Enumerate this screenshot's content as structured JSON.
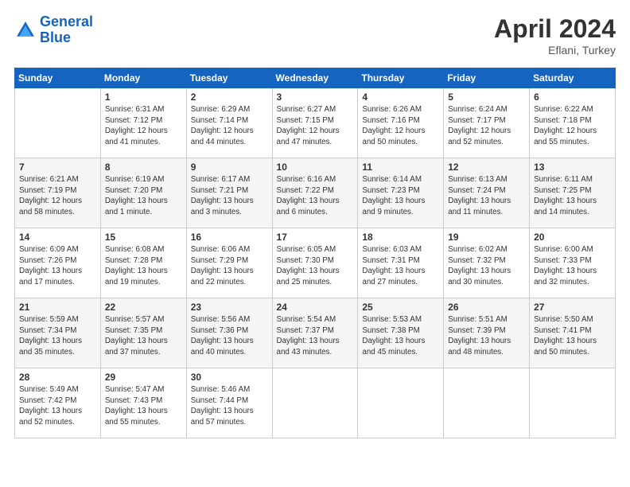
{
  "header": {
    "logo_line1": "General",
    "logo_line2": "Blue",
    "month_year": "April 2024",
    "location": "Eflani, Turkey"
  },
  "days_of_week": [
    "Sunday",
    "Monday",
    "Tuesday",
    "Wednesday",
    "Thursday",
    "Friday",
    "Saturday"
  ],
  "weeks": [
    [
      {
        "day": "",
        "sunrise": "",
        "sunset": "",
        "daylight": ""
      },
      {
        "day": "1",
        "sunrise": "Sunrise: 6:31 AM",
        "sunset": "Sunset: 7:12 PM",
        "daylight": "Daylight: 12 hours and 41 minutes."
      },
      {
        "day": "2",
        "sunrise": "Sunrise: 6:29 AM",
        "sunset": "Sunset: 7:14 PM",
        "daylight": "Daylight: 12 hours and 44 minutes."
      },
      {
        "day": "3",
        "sunrise": "Sunrise: 6:27 AM",
        "sunset": "Sunset: 7:15 PM",
        "daylight": "Daylight: 12 hours and 47 minutes."
      },
      {
        "day": "4",
        "sunrise": "Sunrise: 6:26 AM",
        "sunset": "Sunset: 7:16 PM",
        "daylight": "Daylight: 12 hours and 50 minutes."
      },
      {
        "day": "5",
        "sunrise": "Sunrise: 6:24 AM",
        "sunset": "Sunset: 7:17 PM",
        "daylight": "Daylight: 12 hours and 52 minutes."
      },
      {
        "day": "6",
        "sunrise": "Sunrise: 6:22 AM",
        "sunset": "Sunset: 7:18 PM",
        "daylight": "Daylight: 12 hours and 55 minutes."
      }
    ],
    [
      {
        "day": "7",
        "sunrise": "Sunrise: 6:21 AM",
        "sunset": "Sunset: 7:19 PM",
        "daylight": "Daylight: 12 hours and 58 minutes."
      },
      {
        "day": "8",
        "sunrise": "Sunrise: 6:19 AM",
        "sunset": "Sunset: 7:20 PM",
        "daylight": "Daylight: 13 hours and 1 minute."
      },
      {
        "day": "9",
        "sunrise": "Sunrise: 6:17 AM",
        "sunset": "Sunset: 7:21 PM",
        "daylight": "Daylight: 13 hours and 3 minutes."
      },
      {
        "day": "10",
        "sunrise": "Sunrise: 6:16 AM",
        "sunset": "Sunset: 7:22 PM",
        "daylight": "Daylight: 13 hours and 6 minutes."
      },
      {
        "day": "11",
        "sunrise": "Sunrise: 6:14 AM",
        "sunset": "Sunset: 7:23 PM",
        "daylight": "Daylight: 13 hours and 9 minutes."
      },
      {
        "day": "12",
        "sunrise": "Sunrise: 6:13 AM",
        "sunset": "Sunset: 7:24 PM",
        "daylight": "Daylight: 13 hours and 11 minutes."
      },
      {
        "day": "13",
        "sunrise": "Sunrise: 6:11 AM",
        "sunset": "Sunset: 7:25 PM",
        "daylight": "Daylight: 13 hours and 14 minutes."
      }
    ],
    [
      {
        "day": "14",
        "sunrise": "Sunrise: 6:09 AM",
        "sunset": "Sunset: 7:26 PM",
        "daylight": "Daylight: 13 hours and 17 minutes."
      },
      {
        "day": "15",
        "sunrise": "Sunrise: 6:08 AM",
        "sunset": "Sunset: 7:28 PM",
        "daylight": "Daylight: 13 hours and 19 minutes."
      },
      {
        "day": "16",
        "sunrise": "Sunrise: 6:06 AM",
        "sunset": "Sunset: 7:29 PM",
        "daylight": "Daylight: 13 hours and 22 minutes."
      },
      {
        "day": "17",
        "sunrise": "Sunrise: 6:05 AM",
        "sunset": "Sunset: 7:30 PM",
        "daylight": "Daylight: 13 hours and 25 minutes."
      },
      {
        "day": "18",
        "sunrise": "Sunrise: 6:03 AM",
        "sunset": "Sunset: 7:31 PM",
        "daylight": "Daylight: 13 hours and 27 minutes."
      },
      {
        "day": "19",
        "sunrise": "Sunrise: 6:02 AM",
        "sunset": "Sunset: 7:32 PM",
        "daylight": "Daylight: 13 hours and 30 minutes."
      },
      {
        "day": "20",
        "sunrise": "Sunrise: 6:00 AM",
        "sunset": "Sunset: 7:33 PM",
        "daylight": "Daylight: 13 hours and 32 minutes."
      }
    ],
    [
      {
        "day": "21",
        "sunrise": "Sunrise: 5:59 AM",
        "sunset": "Sunset: 7:34 PM",
        "daylight": "Daylight: 13 hours and 35 minutes."
      },
      {
        "day": "22",
        "sunrise": "Sunrise: 5:57 AM",
        "sunset": "Sunset: 7:35 PM",
        "daylight": "Daylight: 13 hours and 37 minutes."
      },
      {
        "day": "23",
        "sunrise": "Sunrise: 5:56 AM",
        "sunset": "Sunset: 7:36 PM",
        "daylight": "Daylight: 13 hours and 40 minutes."
      },
      {
        "day": "24",
        "sunrise": "Sunrise: 5:54 AM",
        "sunset": "Sunset: 7:37 PM",
        "daylight": "Daylight: 13 hours and 43 minutes."
      },
      {
        "day": "25",
        "sunrise": "Sunrise: 5:53 AM",
        "sunset": "Sunset: 7:38 PM",
        "daylight": "Daylight: 13 hours and 45 minutes."
      },
      {
        "day": "26",
        "sunrise": "Sunrise: 5:51 AM",
        "sunset": "Sunset: 7:39 PM",
        "daylight": "Daylight: 13 hours and 48 minutes."
      },
      {
        "day": "27",
        "sunrise": "Sunrise: 5:50 AM",
        "sunset": "Sunset: 7:41 PM",
        "daylight": "Daylight: 13 hours and 50 minutes."
      }
    ],
    [
      {
        "day": "28",
        "sunrise": "Sunrise: 5:49 AM",
        "sunset": "Sunset: 7:42 PM",
        "daylight": "Daylight: 13 hours and 52 minutes."
      },
      {
        "day": "29",
        "sunrise": "Sunrise: 5:47 AM",
        "sunset": "Sunset: 7:43 PM",
        "daylight": "Daylight: 13 hours and 55 minutes."
      },
      {
        "day": "30",
        "sunrise": "Sunrise: 5:46 AM",
        "sunset": "Sunset: 7:44 PM",
        "daylight": "Daylight: 13 hours and 57 minutes."
      },
      {
        "day": "",
        "sunrise": "",
        "sunset": "",
        "daylight": ""
      },
      {
        "day": "",
        "sunrise": "",
        "sunset": "",
        "daylight": ""
      },
      {
        "day": "",
        "sunrise": "",
        "sunset": "",
        "daylight": ""
      },
      {
        "day": "",
        "sunrise": "",
        "sunset": "",
        "daylight": ""
      }
    ]
  ]
}
